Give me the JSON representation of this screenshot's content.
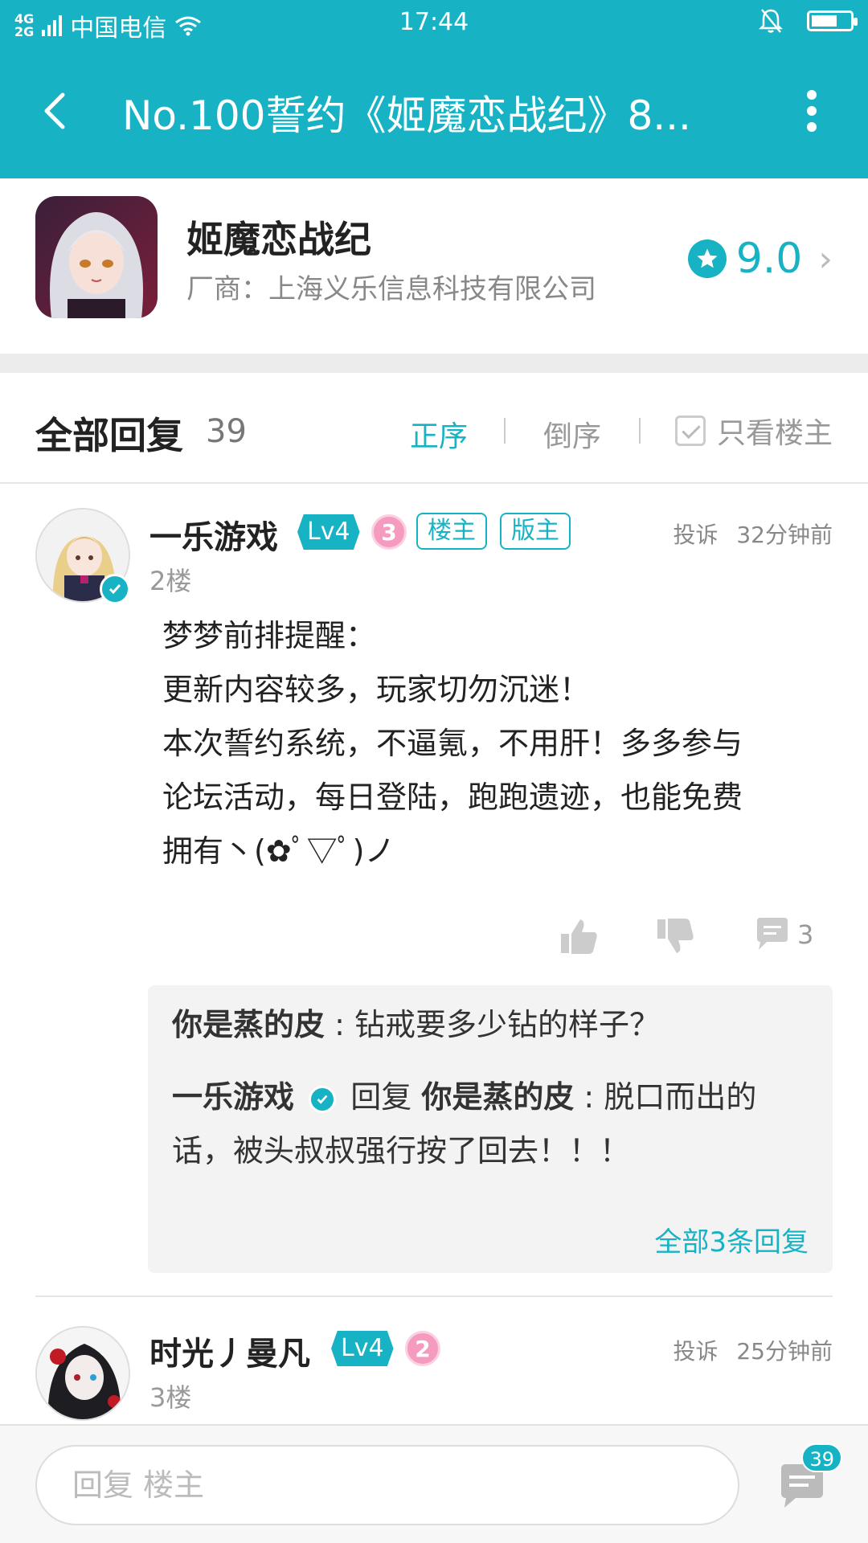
{
  "status_bar": {
    "network_top": "4G",
    "network_bottom": "2G",
    "carrier": "中国电信",
    "time": "17:44",
    "icons": [
      "signal-icon",
      "wifi-icon",
      "bell-muted-icon",
      "battery-icon"
    ],
    "battery_level": 0.6
  },
  "app_bar": {
    "title": "No.100誓约《姬魔恋战纪》8...",
    "icons": [
      "back-arrow-icon",
      "more-vertical-icon"
    ]
  },
  "game": {
    "name": "姬魔恋战纪",
    "maker": "厂商：上海义乐信息科技有限公司",
    "rating": "9.0"
  },
  "replies_header": {
    "title": "全部回复",
    "count": "39",
    "sort_asc": "正序",
    "sort_desc": "倒序",
    "only_owner": "只看楼主"
  },
  "posts": [
    {
      "username": "一乐游戏",
      "level": "Lv4",
      "medal": "3",
      "tags": [
        "楼主",
        "版主"
      ],
      "report": "投诉",
      "time": "32分钟前",
      "floor": "2楼",
      "content": [
        "梦梦前排提醒：",
        "更新内容较多，玩家切勿沉迷！",
        "本次誓约系统，不逼氪，不用肝！多多参与",
        "论坛活动，每日登陆，跑跑遗迹，也能免费",
        "拥有丶(✿ﾟ▽ﾟ)ノ"
      ],
      "comment_count": "3",
      "quotes": [
        {
          "from": "你是蒸的皮",
          "text": "钻戒要多少钻的样子？"
        },
        {
          "from": "一乐游戏",
          "verb": "回复",
          "to": "你是蒸的皮",
          "text_line1": "脱口而出的",
          "text_line2": "话，被头叔叔强行按了回去！！！"
        }
      ],
      "all_replies": "全部3条回复"
    },
    {
      "username": "时光丿曼凡",
      "level": "Lv4",
      "medal": "2",
      "report": "投诉",
      "time": "25分钟前",
      "floor": "3楼"
    }
  ],
  "bottom_bar": {
    "reply_placeholder": "回复  楼主",
    "comment_badge": "39"
  },
  "colors": {
    "accent": "#17b3c4",
    "medal_pink": "#f59bbf",
    "separator": "#ececec"
  }
}
